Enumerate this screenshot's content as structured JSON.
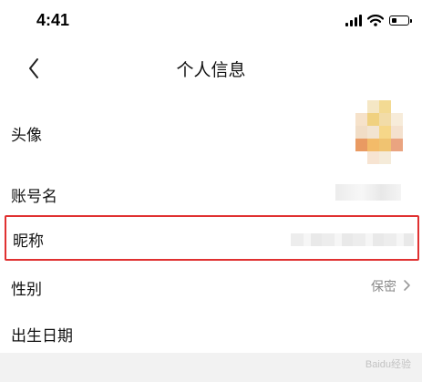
{
  "status_bar": {
    "time": "4:41",
    "icons": [
      "signal-icon",
      "wifi-icon",
      "battery-icon"
    ]
  },
  "nav": {
    "title": "个人信息",
    "back_icon": "chevron-left-icon"
  },
  "rows": {
    "avatar": {
      "label": "头像"
    },
    "account": {
      "label": "账号名"
    },
    "nickname": {
      "label": "昵称"
    },
    "gender": {
      "label": "性别",
      "value": "保密",
      "icon": "chevron-right-icon"
    },
    "birthday": {
      "label": "出生日期"
    }
  },
  "highlight_color": "#e03131",
  "watermark": "Baidu经验"
}
